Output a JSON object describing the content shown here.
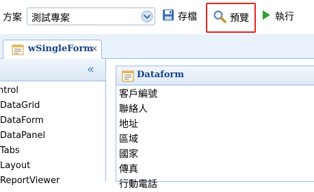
{
  "toolbar": {
    "project_label": "方案",
    "project_selected": "測試專案",
    "save_label": "存檔",
    "preview_label": "預覽",
    "run_label": "執行"
  },
  "tabs": [
    {
      "title": "wSingleForm",
      "close": "×"
    }
  ],
  "left_panel": {
    "collapse_glyph": "«",
    "items": [
      "ntrol",
      "DataGrid",
      "DataForm",
      "DataPanel",
      "Tabs",
      "Layout",
      "ReportViewer"
    ]
  },
  "form_panel": {
    "title": "Dataform",
    "fields": [
      "客戶編號",
      "聯絡人",
      "地址",
      "區域",
      "國家",
      "傳真",
      "行動電話"
    ]
  },
  "colors": {
    "highlight_border": "#e2231a",
    "panel_border": "#99bbe8",
    "header_text": "#15428b"
  },
  "icons": {
    "save": "floppy-disk-icon",
    "preview": "magnifier-icon",
    "run": "play-arrow-icon",
    "tab": "form-icon",
    "form_header": "form-icon"
  }
}
